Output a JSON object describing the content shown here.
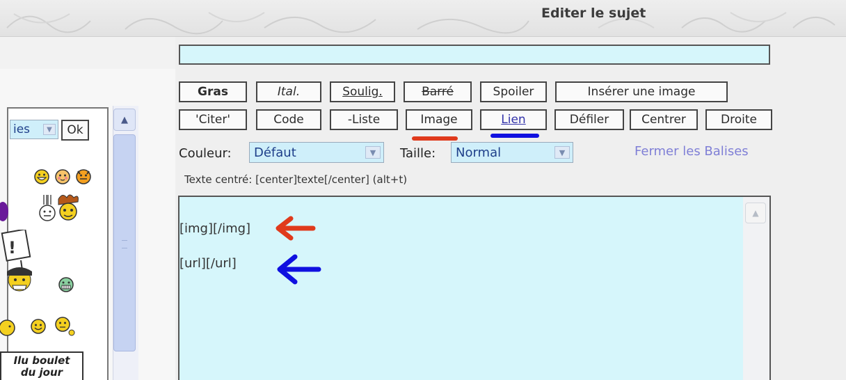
{
  "header": {
    "title": "Editer le sujet"
  },
  "toolbar": {
    "row1": [
      {
        "label": "Gras",
        "style": "bold"
      },
      {
        "label": "Ital.",
        "style": "ital"
      },
      {
        "label": "Soulig.",
        "style": "und"
      },
      {
        "label": "Barré",
        "style": "strike"
      },
      {
        "label": "Spoiler",
        "style": ""
      },
      {
        "label": "Insérer une image",
        "style": ""
      }
    ],
    "row2": [
      {
        "label": "'Citer'",
        "style": ""
      },
      {
        "label": "Code",
        "style": ""
      },
      {
        "label": "-Liste",
        "style": ""
      },
      {
        "label": "Image",
        "style": ""
      },
      {
        "label": "Lien",
        "style": "link"
      },
      {
        "label": "Défiler",
        "style": ""
      },
      {
        "label": "Centrer",
        "style": ""
      },
      {
        "label": "Droite",
        "style": ""
      }
    ]
  },
  "format": {
    "color_label": "Couleur:",
    "color_value": "Défaut",
    "size_label": "Taille:",
    "size_value": "Normal",
    "close_tags": "Fermer les Balises"
  },
  "hint": "Texte centré: [center]texte[/center]  (alt+t)",
  "editor": {
    "line1": "[img][/img]",
    "line2": "[url][/url]"
  },
  "smiley_panel": {
    "select_value": "ies",
    "ok_label": "Ok",
    "banner_line1": "Ilu boulet",
    "banner_line2": "du jour"
  },
  "annotations": {
    "image_underline_color": "#e03a1c",
    "link_underline_color": "#1010e0",
    "arrow1_color": "#e03a1c",
    "arrow2_color": "#1010e0"
  },
  "colors": {
    "editor_bg": "#d6f6fb",
    "close_tags_color": "#7f7fd6"
  }
}
